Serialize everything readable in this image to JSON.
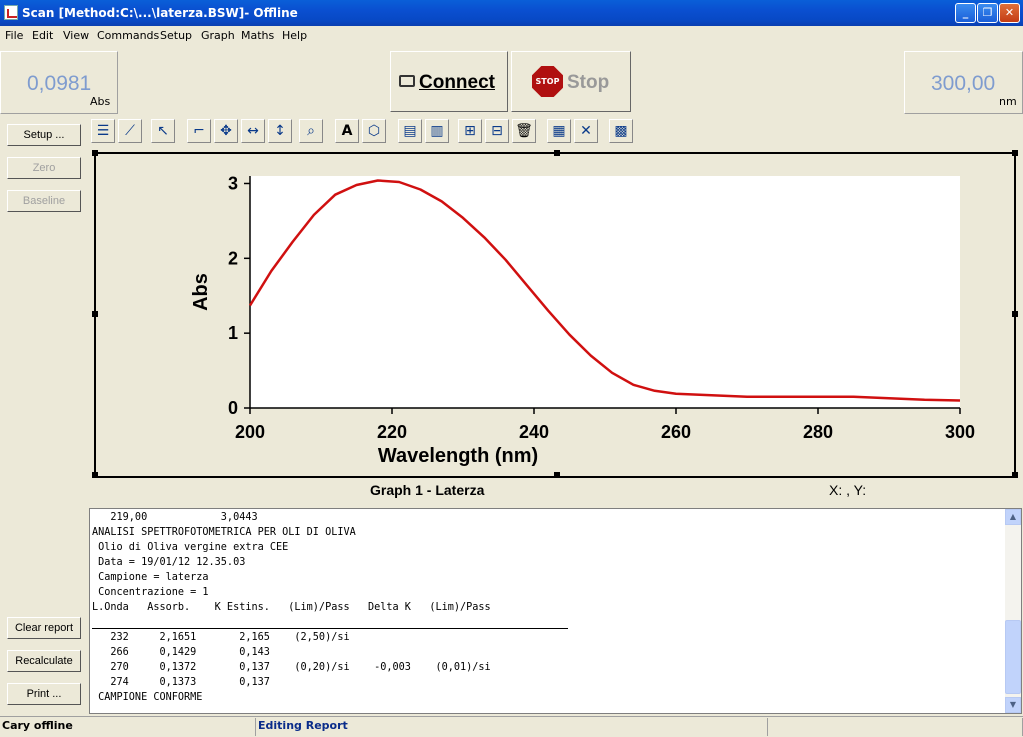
{
  "window": {
    "title": "Scan [Method:C:\\...\\laterza.BSW]- Offline",
    "buttons": [
      "minimize",
      "maximize",
      "close"
    ]
  },
  "menu": [
    "File",
    "Edit",
    "View",
    "Commands",
    "Setup",
    "Graph",
    "Maths",
    "Help"
  ],
  "readouts": {
    "abs_value": "0,0981",
    "abs_unit": "Abs",
    "nm_value": "300,00",
    "nm_unit": "nm"
  },
  "actions": {
    "connect_label": "Connect",
    "stop_label": "Stop",
    "stop_icon_text": "STOP"
  },
  "left_buttons": {
    "setup": "Setup ...",
    "zero": "Zero",
    "baseline": "Baseline",
    "clear_report": "Clear report",
    "recalculate": "Recalculate",
    "print": "Print ..."
  },
  "toolbar_icons": [
    "legend-icon",
    "graph-properties-icon",
    "pointer-icon",
    "cursor-icon",
    "move-icon",
    "horizontal-scale-icon",
    "vertical-scale-icon",
    "zoom-icon",
    "text-icon",
    "label-icon",
    "overlay-icon",
    "overlay2-icon",
    "autoscale-icon",
    "autoscale-y-icon",
    "delete-icon",
    "trace-prefs-icon",
    "trace-select-icon",
    "calculator-icon"
  ],
  "graph": {
    "caption": "Graph 1 - Laterza",
    "xy_readout": "X: , Y:"
  },
  "chart_data": {
    "type": "line",
    "xlabel": "Wavelength (nm)",
    "ylabel": "Abs",
    "xlim": [
      200,
      300
    ],
    "ylim": [
      0,
      3.1
    ],
    "xticks": [
      200,
      220,
      240,
      260,
      280,
      300
    ],
    "yticks": [
      0,
      1,
      2,
      3
    ],
    "series": [
      {
        "color": "#d01010",
        "x": [
          200,
          203,
          206,
          209,
          212,
          215,
          218,
          221,
          224,
          227,
          230,
          233,
          236,
          239,
          242,
          245,
          248,
          251,
          254,
          257,
          260,
          265,
          270,
          275,
          280,
          285,
          290,
          295,
          300
        ],
        "y": [
          1.37,
          1.83,
          2.22,
          2.58,
          2.85,
          2.98,
          3.04,
          3.02,
          2.92,
          2.76,
          2.54,
          2.28,
          1.98,
          1.64,
          1.3,
          0.98,
          0.7,
          0.47,
          0.31,
          0.23,
          0.19,
          0.17,
          0.15,
          0.15,
          0.15,
          0.15,
          0.13,
          0.11,
          0.1
        ]
      }
    ]
  },
  "report": {
    "lines": [
      "   219,00            3,0443",
      "ANALISI SPETTROFOTOMETRICA PER OLI DI OLIVA",
      " Olio di Oliva vergine extra CEE",
      " Data = 19/01/12 12.35.03",
      " Campione = laterza",
      " Concentrazione = 1",
      "L.Onda   Assorb.    K Estins.   (Lim)/Pass   Delta K   (Lim)/Pass",
      "",
      "   232     2,1651       2,165    (2,50)/si",
      "   266     0,1429       0,143",
      "   270     0,1372       0,137    (0,20)/si    -0,003    (0,01)/si",
      "   274     0,1373       0,137",
      " CAMPIONE CONFORME"
    ]
  },
  "status": {
    "left": "Cary offline",
    "middle": "Editing Report",
    "right": ""
  }
}
